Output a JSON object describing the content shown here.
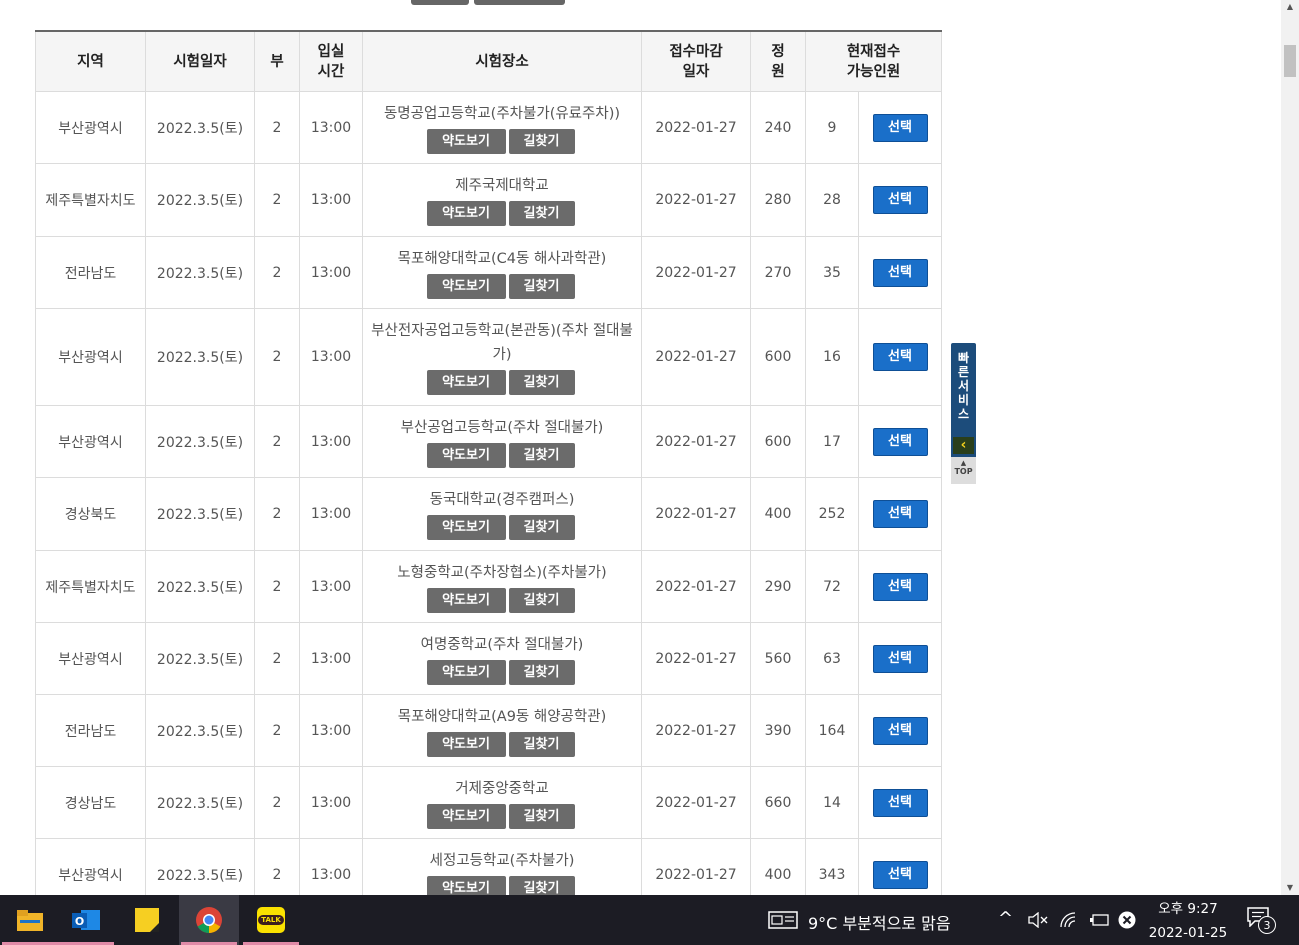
{
  "headers": {
    "region": "지역",
    "date": "시험일자",
    "part": "부",
    "entry_line1": "입실",
    "entry_line2": "시간",
    "place": "시험장소",
    "deadline_line1": "접수마감",
    "deadline_line2": "일자",
    "capacity_line1": "정",
    "capacity_line2": "원",
    "available_line1": "현재접수",
    "available_line2": "가능인원"
  },
  "buttons": {
    "map": "약도보기",
    "way": "길찾기",
    "select": "선택"
  },
  "rows": [
    {
      "region": "부산광역시",
      "date": "2022.3.5(토)",
      "part": "2",
      "time": "13:00",
      "place": "동명공업고등학교(주차불가(유료주차))",
      "deadline": "2022-01-27",
      "capacity": "240",
      "available": "9"
    },
    {
      "region": "제주특별자치도",
      "date": "2022.3.5(토)",
      "part": "2",
      "time": "13:00",
      "place": "제주국제대학교",
      "deadline": "2022-01-27",
      "capacity": "280",
      "available": "28"
    },
    {
      "region": "전라남도",
      "date": "2022.3.5(토)",
      "part": "2",
      "time": "13:00",
      "place": "목포해양대학교(C4동 해사과학관)",
      "deadline": "2022-01-27",
      "capacity": "270",
      "available": "35"
    },
    {
      "region": "부산광역시",
      "date": "2022.3.5(토)",
      "part": "2",
      "time": "13:00",
      "place": "부산전자공업고등학교(본관동)(주차 절대불가)",
      "deadline": "2022-01-27",
      "capacity": "600",
      "available": "16"
    },
    {
      "region": "부산광역시",
      "date": "2022.3.5(토)",
      "part": "2",
      "time": "13:00",
      "place": "부산공업고등학교(주차 절대불가)",
      "deadline": "2022-01-27",
      "capacity": "600",
      "available": "17"
    },
    {
      "region": "경상북도",
      "date": "2022.3.5(토)",
      "part": "2",
      "time": "13:00",
      "place": "동국대학교(경주캠퍼스)",
      "deadline": "2022-01-27",
      "capacity": "400",
      "available": "252"
    },
    {
      "region": "제주특별자치도",
      "date": "2022.3.5(토)",
      "part": "2",
      "time": "13:00",
      "place": "노형중학교(주차장협소)(주차불가)",
      "deadline": "2022-01-27",
      "capacity": "290",
      "available": "72"
    },
    {
      "region": "부산광역시",
      "date": "2022.3.5(토)",
      "part": "2",
      "time": "13:00",
      "place": "여명중학교(주차 절대불가)",
      "deadline": "2022-01-27",
      "capacity": "560",
      "available": "63"
    },
    {
      "region": "전라남도",
      "date": "2022.3.5(토)",
      "part": "2",
      "time": "13:00",
      "place": "목포해양대학교(A9동 해양공학관)",
      "deadline": "2022-01-27",
      "capacity": "390",
      "available": "164"
    },
    {
      "region": "경상남도",
      "date": "2022.3.5(토)",
      "part": "2",
      "time": "13:00",
      "place": "거제중앙중학교",
      "deadline": "2022-01-27",
      "capacity": "660",
      "available": "14"
    },
    {
      "region": "부산광역시",
      "date": "2022.3.5(토)",
      "part": "2",
      "time": "13:00",
      "place": "세정고등학교(주차불가)",
      "deadline": "2022-01-27",
      "capacity": "400",
      "available": "343"
    }
  ],
  "quick_service": {
    "label": "빠른서비스",
    "top": "TOP"
  },
  "taskbar": {
    "weather": "9°C  부분적으로 맑음",
    "time": "오후 9:27",
    "date": "2022-01-25",
    "notification_count": "3",
    "talk_label": "TALK"
  },
  "colors": {
    "select_button": "#1a6fc9",
    "place_button": "#6b6b6b",
    "quick_service": "#1c4c7b",
    "taskbar": "#1c1c24"
  }
}
